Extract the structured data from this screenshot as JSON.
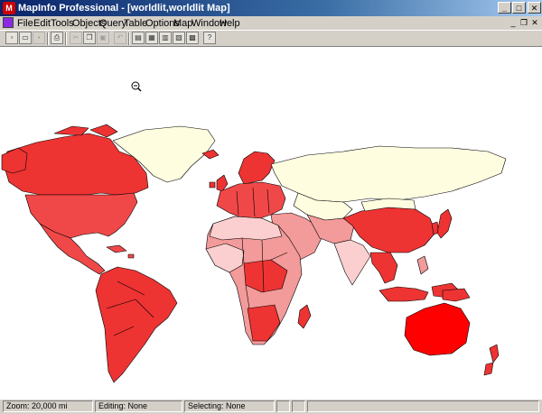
{
  "titlebar": {
    "title": "MapInfo Professional - [worldlit,worldlit Map]"
  },
  "menubar": {
    "items": [
      "File",
      "Edit",
      "Tools",
      "Objects",
      "Query",
      "Table",
      "Options",
      "Map",
      "Window",
      "Help"
    ]
  },
  "statusbar": {
    "zoom": "Zoom: 20,000 mi",
    "editing": "Editing: None",
    "selecting": "Selecting: None"
  },
  "colors": {
    "dark_red": "#ee3333",
    "red": "#f04848",
    "pink": "#f39a9a",
    "light_pink": "#fbcfcf",
    "cream": "#fffde0",
    "title_gradient_start": "#0a246a"
  },
  "icons": {
    "toolbar": [
      "new-icon",
      "open-icon",
      "save-icon",
      "print-icon",
      "cut-icon",
      "copy-icon",
      "paste-icon",
      "undo-icon",
      "map-icon",
      "browser-icon",
      "graph-icon",
      "layout-icon",
      "redistrict-icon",
      "help-icon"
    ],
    "map_cursor": "zoom-out-icon"
  }
}
